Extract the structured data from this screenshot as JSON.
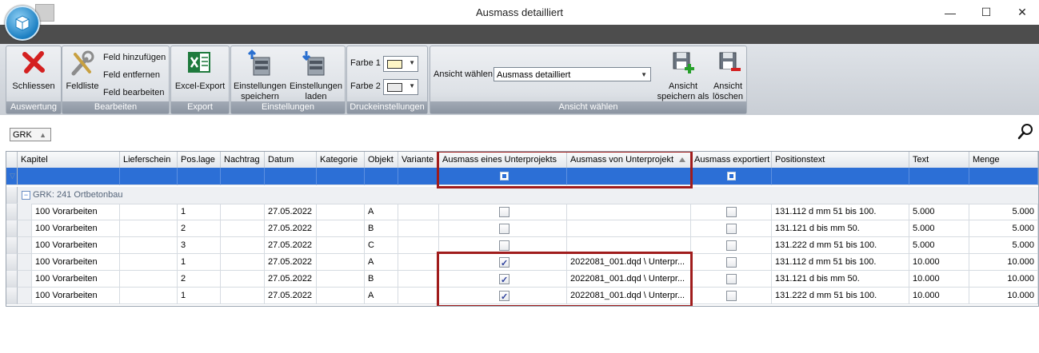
{
  "window": {
    "title": "Ausmass detailliert",
    "minimize": "—",
    "maximize": "☐",
    "close": "✕"
  },
  "ribbon": {
    "groups": {
      "auswertung": "Auswertung",
      "bearbeiten": "Bearbeiten",
      "export": "Export",
      "einstellungen": "Einstellungen",
      "druckeinstellungen": "Druckeinstellungen",
      "ansicht_waehlen": "Ansicht wählen"
    },
    "schliessen": "Schliessen",
    "feldliste": "Feldliste",
    "feld_hinzufuegen": "Feld hinzufügen",
    "feld_entfernen": "Feld entfernen",
    "feld_bearbeiten": "Feld bearbeiten",
    "excel_export": "Excel-Export",
    "einstellungen_speichern_1": "Einstellungen",
    "einstellungen_speichern_2": "speichern",
    "einstellungen_laden_1": "Einstellungen",
    "einstellungen_laden_2": "laden",
    "farbe1": "Farbe 1",
    "farbe2": "Farbe 2",
    "farbe1_color": "#fdf5c6",
    "farbe2_color": "#e9e9e9",
    "ansicht_label": "Ansicht wählen",
    "ansicht_value": "Ausmass detailliert",
    "ansicht_speichern_1": "Ansicht",
    "ansicht_speichern_2": "speichern als",
    "ansicht_loeschen_1": "Ansicht",
    "ansicht_loeschen_2": "löschen"
  },
  "group_panel": {
    "chip": "GRK"
  },
  "grid": {
    "columns": [
      "Kapitel",
      "Lieferschein",
      "Pos.lage",
      "Nachtrag",
      "Datum",
      "Kategorie",
      "Objekt",
      "Variante",
      "Ausmass eines Unterprojekts",
      "Ausmass von Unterprojekt",
      "Ausmass exportiert",
      "Positionstext",
      "Text",
      "Menge"
    ],
    "group_label": "GRK: 241 Ortbetonbau",
    "group_toggle": "−",
    "rows": [
      {
        "kapitel": "100 Vorarbeiten",
        "poslage": "1",
        "datum": "27.05.2022",
        "objekt": "A",
        "unterprojekts": false,
        "von": "",
        "exportiert": false,
        "positionstext": "131.112 d mm 51 bis 100.",
        "text": "5.000",
        "menge": "5.000"
      },
      {
        "kapitel": "100 Vorarbeiten",
        "poslage": "2",
        "datum": "27.05.2022",
        "objekt": "B",
        "unterprojekts": false,
        "von": "",
        "exportiert": false,
        "positionstext": "131.121 d bis mm 50.",
        "text": "5.000",
        "menge": "5.000"
      },
      {
        "kapitel": "100 Vorarbeiten",
        "poslage": "3",
        "datum": "27.05.2022",
        "objekt": "C",
        "unterprojekts": false,
        "von": "",
        "exportiert": false,
        "positionstext": "131.222 d mm 51 bis 100.",
        "text": "5.000",
        "menge": "5.000"
      },
      {
        "kapitel": "100 Vorarbeiten",
        "poslage": "1",
        "datum": "27.05.2022",
        "objekt": "A",
        "unterprojekts": true,
        "von": "2022081_001.dqd \\ Unterpr...",
        "exportiert": false,
        "positionstext": "131.112 d mm 51 bis 100.",
        "text": "10.000",
        "menge": "10.000"
      },
      {
        "kapitel": "100 Vorarbeiten",
        "poslage": "2",
        "datum": "27.05.2022",
        "objekt": "B",
        "unterprojekts": true,
        "von": "2022081_001.dqd \\ Unterpr...",
        "exportiert": false,
        "positionstext": "131.121 d bis mm 50.",
        "text": "10.000",
        "menge": "10.000"
      },
      {
        "kapitel": "100 Vorarbeiten",
        "poslage": "1",
        "datum": "27.05.2022",
        "objekt": "A",
        "unterprojekts": true,
        "von": "2022081_001.dqd \\ Unterpr...",
        "exportiert": false,
        "positionstext": "131.222 d mm 51 bis 100.",
        "text": "10.000",
        "menge": "10.000"
      }
    ]
  }
}
